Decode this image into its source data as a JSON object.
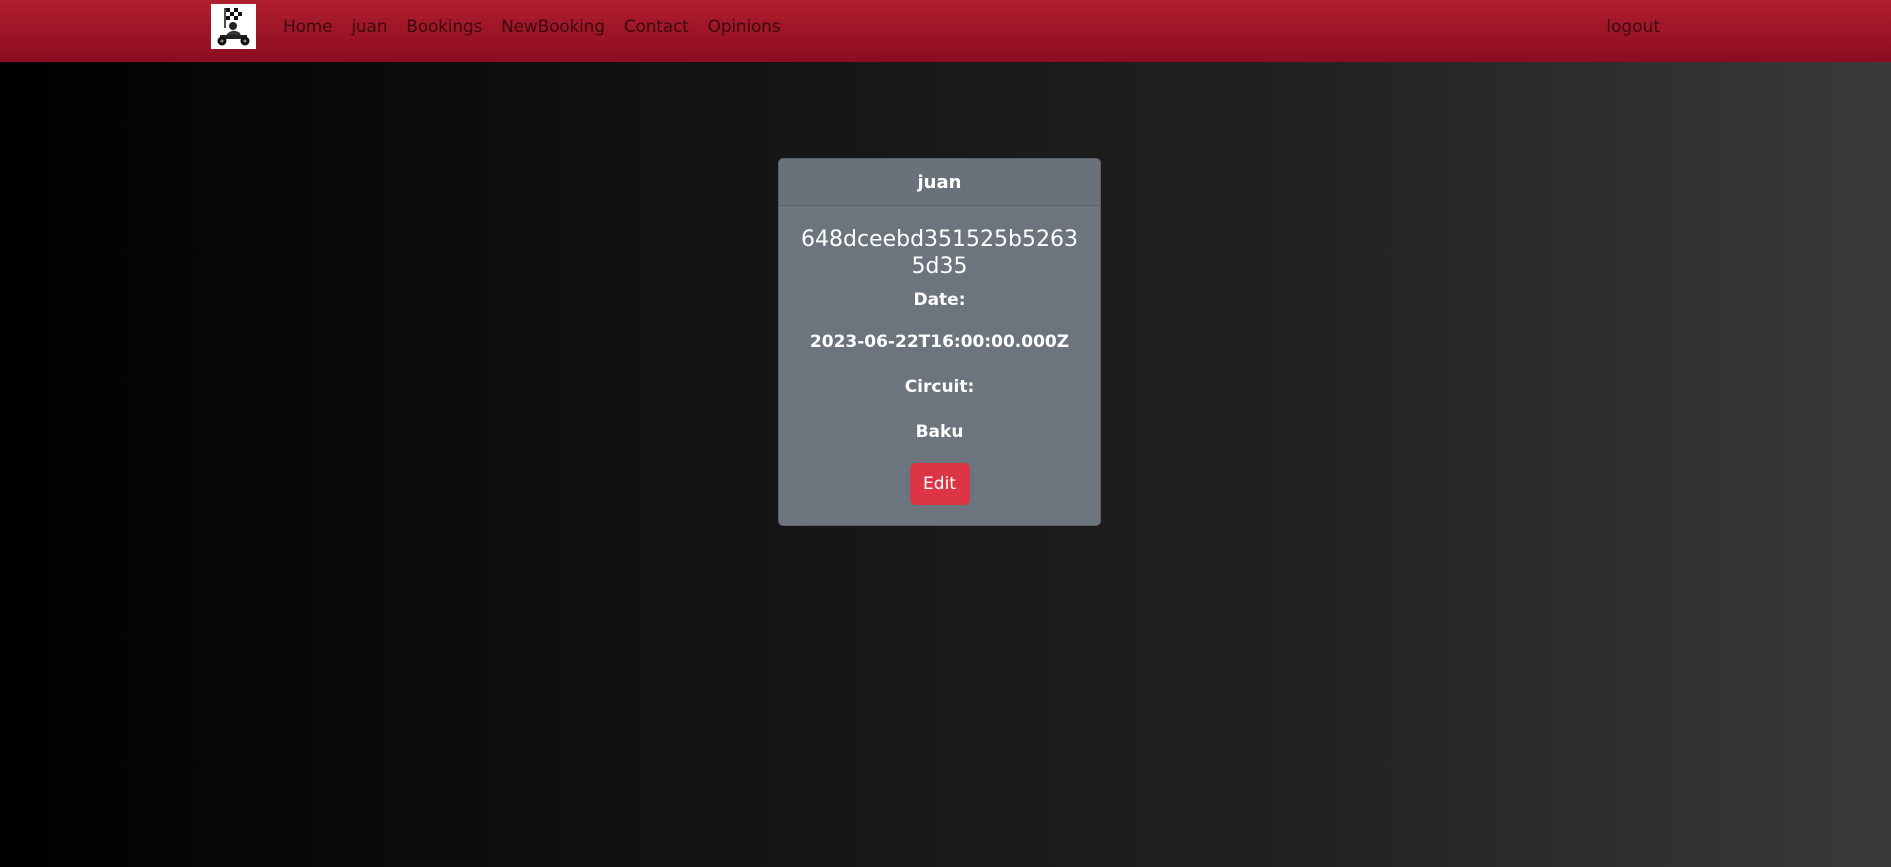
{
  "nav": {
    "logo_icon": "go-kart-logo-icon",
    "links": [
      "Home",
      "juan",
      "Bookings",
      "NewBooking",
      "Contact",
      "Opinions"
    ],
    "logout": "logout"
  },
  "booking": {
    "user": "juan",
    "id": "648dceebd351525b52635d35",
    "date_label": "Date:",
    "date_value": "2023-06-22T16:00:00.000Z",
    "circuit_label": "Circuit:",
    "circuit_value": "Baku",
    "edit_label": "Edit"
  },
  "colors": {
    "navbar": "#a5192b",
    "card": "#6c757d",
    "edit_button": "#dc3545"
  }
}
